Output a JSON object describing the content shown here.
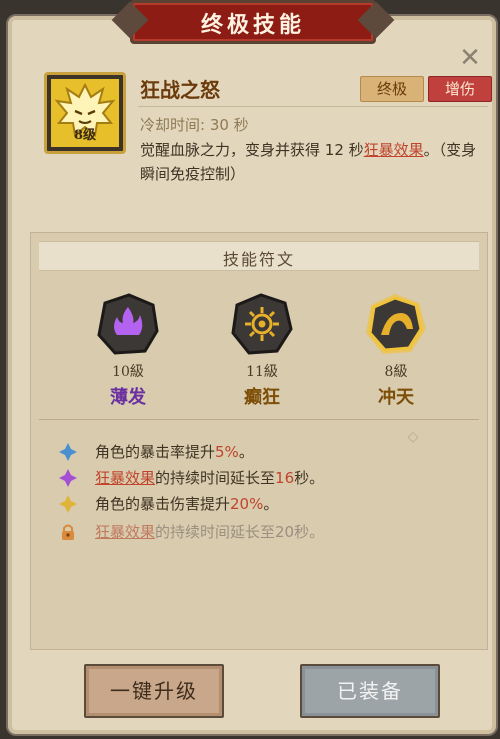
{
  "dialog": {
    "title": "终极技能",
    "close_symbol": "✕"
  },
  "skill": {
    "name": "狂战之怒",
    "level": "8级",
    "tags": [
      "终极",
      "增伤"
    ],
    "cooldown": "冷却时间: 30 秒",
    "desc_before": "觉醒血脉之力，变身并获得 12 秒",
    "desc_link": "狂暴效果",
    "desc_after": "。（变身瞬间免疫控制）"
  },
  "runes": {
    "header": "技能符文",
    "items": [
      {
        "level": "10級",
        "name": "薄发",
        "color": "#7a3fb0"
      },
      {
        "level": "11級",
        "name": "癫狂",
        "color": "#8a5a10"
      },
      {
        "level": "8級",
        "name": "冲天",
        "color": "#8a5a10"
      }
    ]
  },
  "effects": [
    {
      "icon": "blue-diamond-icon",
      "parts": [
        {
          "text": "角色的暴击率提升",
          "style": "normal"
        },
        {
          "text": "5%",
          "style": "hl"
        },
        {
          "text": "。",
          "style": "normal"
        }
      ]
    },
    {
      "icon": "purple-diamond-icon",
      "parts": [
        {
          "text": "狂暴效果",
          "style": "link"
        },
        {
          "text": "的持续时间延长至",
          "style": "normal"
        },
        {
          "text": "16",
          "style": "hl"
        },
        {
          "text": "秒。",
          "style": "normal"
        }
      ]
    },
    {
      "icon": "gold-diamond-icon",
      "parts": [
        {
          "text": "角色的暴击伤害提升",
          "style": "normal"
        },
        {
          "text": "20%",
          "style": "hl"
        },
        {
          "text": "。",
          "style": "normal"
        }
      ]
    },
    {
      "icon": "lock-icon",
      "parts": [
        {
          "text": "狂暴效果",
          "style": "link-muted"
        },
        {
          "text": "的持续时间延长至20秒。",
          "style": "muted"
        }
      ]
    }
  ],
  "buttons": {
    "upgrade": "一键升级",
    "equipped": "已装备"
  }
}
